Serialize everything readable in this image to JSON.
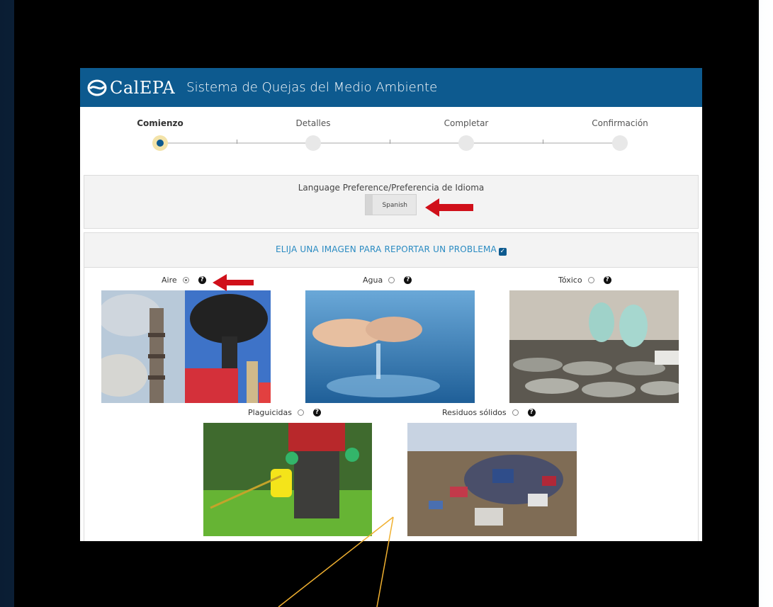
{
  "header": {
    "logo_text": "CalEPA",
    "title": "Sistema de Quejas del Medio Ambiente",
    "color": "#0d5a8f"
  },
  "steps": [
    {
      "label": "Comienzo",
      "active": true
    },
    {
      "label": "Detalles",
      "active": false
    },
    {
      "label": "Completar",
      "active": false
    },
    {
      "label": "Confirmación",
      "active": false
    }
  ],
  "language": {
    "label": "Language Preference/Preferencia de Idioma",
    "button": "Spanish"
  },
  "choose": {
    "text": "ELIJA UNA IMAGEN PARA REPORTAR UN PROBLEMA",
    "color": "#2a8bc2"
  },
  "options": [
    {
      "label": "Aire",
      "selected": true,
      "image": "air-pollution-smokestacks"
    },
    {
      "label": "Agua",
      "selected": false,
      "image": "hands-in-water"
    },
    {
      "label": "Tóxico",
      "selected": false,
      "image": "hazmat-workers-barrels"
    },
    {
      "label": "Plaguicidas",
      "selected": false,
      "image": "pesticide-sprayer"
    },
    {
      "label": "Residuos sólidos",
      "selected": false,
      "image": "solid-waste-dump"
    }
  ],
  "help_glyph": "?",
  "annotation_arrow_color": "#d0101a",
  "annotation_line_color": "#f0b030"
}
